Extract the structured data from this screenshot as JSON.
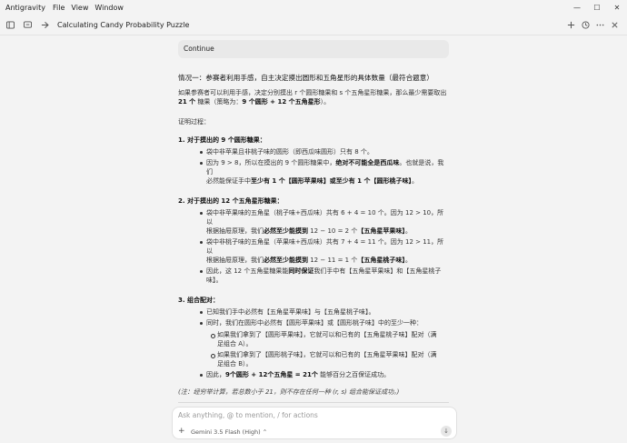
{
  "app": {
    "name": "Antigravity",
    "menus": [
      "File",
      "View",
      "Window"
    ],
    "window_controls": {
      "minimize": "—",
      "maximize": "☐",
      "close": "✕"
    }
  },
  "titlebar": {
    "conversation_title": "Calculating Candy Probability Puzzle",
    "left_icons": [
      "panel-icon",
      "chat-icon",
      "back-arrow-icon"
    ],
    "right_icons": [
      "add-icon",
      "history-icon",
      "more-icon",
      "close-icon"
    ]
  },
  "continue_label": "Continue",
  "scenario_title": "情况一：参赛者利用手感，自主决定摸出圆形和五角星形的具体数量（最符合题意）",
  "intro": {
    "line1": "如果参赛者可以利用手感，决定分别摸出 r 个圆形糖果和 s 个五角星形糖果，那么最少需要取出",
    "line2_bold1": "21 个",
    "line2_text": "糖果（策略为：",
    "line2_bold2": "9 个圆形 + 12 个五角星形",
    "line2_end": "）。"
  },
  "proof_head": "证明过程：",
  "section1": {
    "title": "1. 对于摸出的 9 个圆形糖果：",
    "item1": "袋中非苹果且非桃子味的圆形（即西瓜味圆形）只有 8 个。",
    "item2_a": "因为 9 > 8，所以在摸出的 9 个圆形糖果中，",
    "item2_bold": "绝对不可能全是西瓜味",
    "item2_b": "。也就是说，我们",
    "item2_c": "必然能保证手中",
    "item2_bold2": "至少有 1 个【圆形苹果味】或至少有 1 个【圆形桃子味】",
    "item2_d": "。"
  },
  "section2": {
    "title": "2. 对于摸出的 12 个五角星形糖果：",
    "item1_a": "袋中非苹果味的五角星（桃子味+西瓜味）共有 6 + 4 = 10 个。因为 12 > 10，所以",
    "item1_b": "根据抽屉原理，我们",
    "item1_bold": "必然至少能摸到",
    "item1_c": " 12 − 10 = 2 个",
    "item1_bold2": "【五角星苹果味】",
    "item1_d": "。",
    "item2_a": "袋中非桃子味的五角星（苹果味+西瓜味）共有 7 + 4 = 11 个。因为 12 > 11，所以",
    "item2_b": "根据抽屉原理，我们",
    "item2_bold": "必然至少能摸到",
    "item2_c": " 12 − 11 = 1 个",
    "item2_bold2": "【五角星桃子味】",
    "item2_d": "。",
    "item3_a": "因此，这 12 个五角星糖果能",
    "item3_bold": "同时保证",
    "item3_b": "我们手中有【五角星苹果味】和【五角星桃子",
    "item3_c": "味】。"
  },
  "section3": {
    "title": "3. 组合配对：",
    "item1": "已知我们手中必然有【五角星苹果味】与【五角星桃子味】。",
    "item2": "同时，我们在圆形中必然有【圆形苹果味】或【圆形桃子味】中的至少一种：",
    "sub1_a": "如果我们拿到了【圆形苹果味】，它就可以和已有的【五角星桃子味】配对（满",
    "sub1_b": "足组合 A）。",
    "sub2_a": "如果我们拿到了【圆形桃子味】，它就可以和已有的【五角星苹果味】配对（满",
    "sub2_b": "足组合 B）。",
    "item3_a": "因此，",
    "item3_bold": "9个圆形 + 12个五角星 = 21个",
    "item3_b": " 能够百分之百保证成功。"
  },
  "note": "(注：经穷举计算，若总数小于 21，则不存在任何一种 (r, s) 组合能保证成功。)",
  "input": {
    "placeholder": "Ask anything, @ to mention, / for actions",
    "plus": "+",
    "model": "Gemini 3.5 Flash (High)",
    "model_caret": "⌃",
    "mic": "↓"
  }
}
